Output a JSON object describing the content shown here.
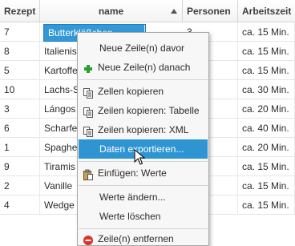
{
  "columns": [
    "Rezept",
    "name",
    "Personen",
    "Arbeitszeit"
  ],
  "rows": [
    {
      "rezept": "7",
      "name": "Butterklößchen",
      "personen": "3",
      "zeit": "ca. 15 Min."
    },
    {
      "rezept": "8",
      "name": "Italienische",
      "personen": "",
      "zeit": "ca. 15 Min."
    },
    {
      "rezept": "5",
      "name": "Kartoffel",
      "personen": "",
      "zeit": "ca. 15 Min."
    },
    {
      "rezept": "10",
      "name": "Lachs-S",
      "personen": "",
      "zeit": "ca. 30 Min."
    },
    {
      "rezept": "3",
      "name": "Lángos",
      "personen": "",
      "zeit": "ca. 20 Min."
    },
    {
      "rezept": "6",
      "name": "Scharfe",
      "personen": "",
      "zeit": "ca. 40 Min."
    },
    {
      "rezept": "1",
      "name": "Spaghe",
      "personen": "",
      "zeit": "ca. 20 Min."
    },
    {
      "rezept": "9",
      "name": "Tiramis",
      "personen": "",
      "zeit": "ca. 15 Min."
    },
    {
      "rezept": "2",
      "name": "Vanille",
      "personen": "",
      "zeit": "ca. 15 Min."
    },
    {
      "rezept": "4",
      "name": "Wedge",
      "personen": "",
      "zeit": "ca. 15 Min."
    }
  ],
  "context_menu": [
    {
      "label": "Neue Zeile(n) davor",
      "icon": ""
    },
    {
      "label": "Neue Zeile(n) danach",
      "icon": "plus-icon"
    },
    {
      "label": "Zellen kopieren",
      "icon": "copy-icon"
    },
    {
      "label": "Zeilen kopieren: Tabelle",
      "icon": "copy-icon"
    },
    {
      "label": "Zeilen kopieren: XML",
      "icon": "copy-icon"
    },
    {
      "label": "Daten exportieren...",
      "icon": ""
    },
    {
      "label": "Einfügen: Werte",
      "icon": "paste-icon"
    },
    {
      "label": "Werte ändern...",
      "icon": ""
    },
    {
      "label": "Werte löschen",
      "icon": ""
    },
    {
      "label": "Zeile(n) entfernen",
      "icon": "remove-icon"
    }
  ],
  "colors": {
    "selection": "#3399d6",
    "menu_highlight": "#2f95d2",
    "plus": "#2e9e2e",
    "remove": "#d9332b"
  }
}
